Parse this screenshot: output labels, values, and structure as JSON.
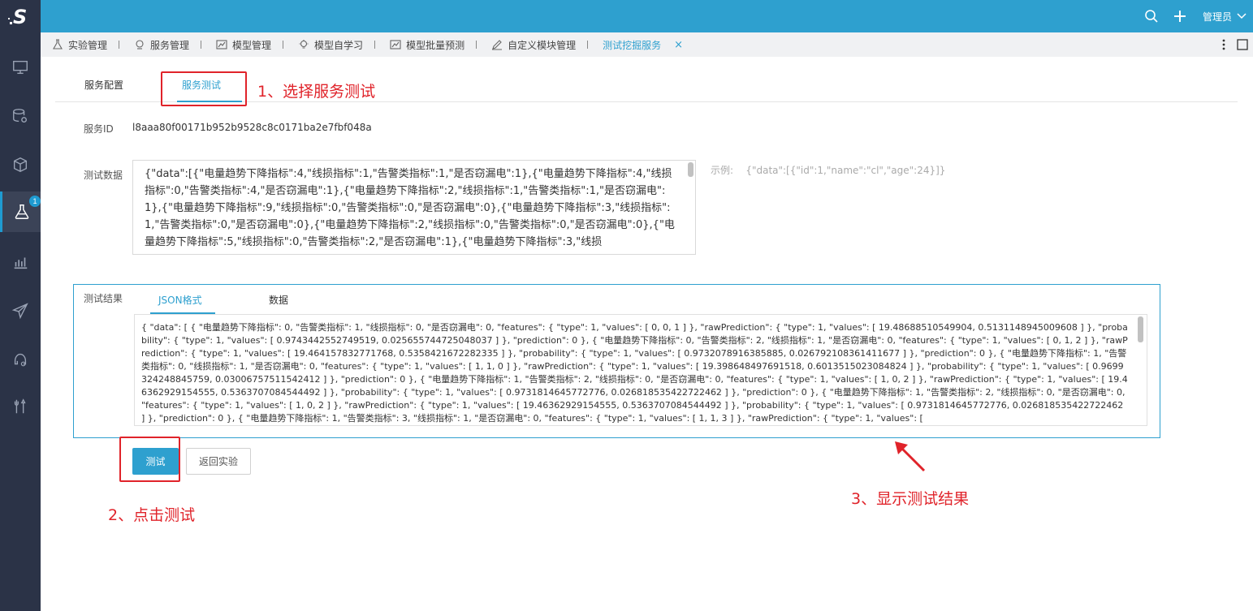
{
  "app": {
    "logo_text": "S",
    "user": "管理员"
  },
  "sidebar": {
    "badge": "1",
    "items": [
      {
        "icon": "monitor-icon"
      },
      {
        "icon": "database-gear-icon"
      },
      {
        "icon": "cube-icon"
      },
      {
        "icon": "flask-icon",
        "active": true
      },
      {
        "icon": "bar-chart-icon"
      },
      {
        "icon": "paper-plane-icon"
      },
      {
        "icon": "model-gear-icon"
      },
      {
        "icon": "tools-icon"
      }
    ]
  },
  "tabs": [
    {
      "label": "实验管理",
      "icon": "flask-icon"
    },
    {
      "label": "服务管理",
      "icon": "service-icon"
    },
    {
      "label": "模型管理",
      "icon": "chart-icon"
    },
    {
      "label": "模型自学习",
      "icon": "bulb-icon"
    },
    {
      "label": "模型批量预测",
      "icon": "chart-icon"
    },
    {
      "label": "自定义模块管理",
      "icon": "edit-icon"
    },
    {
      "label": "测试挖掘服务",
      "active": true,
      "close": "×"
    }
  ],
  "subtabs": {
    "config": "服务配置",
    "test": "服务测试"
  },
  "service": {
    "id_label": "服务ID",
    "id_value": "l8aaa80f00171b952b9528c8c0171ba2e7fbf048a"
  },
  "test_data": {
    "label": "测试数据",
    "value": "{\"data\":[{\"电量趋势下降指标\":4,\"线损指标\":1,\"告警类指标\":1,\"是否窃漏电\":1},{\"电量趋势下降指标\":4,\"线损指标\":0,\"告警类指标\":4,\"是否窃漏电\":1},{\"电量趋势下降指标\":2,\"线损指标\":1,\"告警类指标\":1,\"是否窃漏电\":1},{\"电量趋势下降指标\":9,\"线损指标\":0,\"告警类指标\":0,\"是否窃漏电\":0},{\"电量趋势下降指标\":3,\"线损指标\":1,\"告警类指标\":0,\"是否窃漏电\":0},{\"电量趋势下降指标\":2,\"线损指标\":0,\"告警类指标\":0,\"是否窃漏电\":0},{\"电量趋势下降指标\":5,\"线损指标\":0,\"告警类指标\":2,\"是否窃漏电\":1},{\"电量趋势下降指标\":3,\"线损",
    "example_label": "示例:",
    "example_value": "{\"data\":[{\"id\":1,\"name\":\"cl\",\"age\":24}]}"
  },
  "result": {
    "label": "测试结果",
    "tab_json": "JSON格式",
    "tab_data": "数据",
    "json": "{ \"data\": [ { \"电量趋势下降指标\": 0, \"告警类指标\": 1, \"线损指标\": 0, \"是否窃漏电\": 0, \"features\": { \"type\": 1, \"values\": [ 0, 0, 1 ] }, \"rawPrediction\": { \"type\": 1, \"values\": [ 19.48688510549904, 0.5131148945009608 ] }, \"probability\": { \"type\": 1, \"values\": [ 0.9743442552749519, 0.025655744725048037 ] }, \"prediction\": 0 }, { \"电量趋势下降指标\": 0, \"告警类指标\": 2, \"线损指标\": 1, \"是否窃漏电\": 0, \"features\": { \"type\": 1, \"values\": [ 0, 1, 2 ] }, \"rawPrediction\": { \"type\": 1, \"values\": [ 19.464157832771768, 0.5358421672282335 ] }, \"probability\": { \"type\": 1, \"values\": [ 0.9732078916385885, 0.026792108361411677 ] }, \"prediction\": 0 }, { \"电量趋势下降指标\": 1, \"告警类指标\": 0, \"线损指标\": 1, \"是否窃漏电\": 0, \"features\": { \"type\": 1, \"values\": [ 1, 1, 0 ] }, \"rawPrediction\": { \"type\": 1, \"values\": [ 19.398648497691518, 0.6013515023084824 ] }, \"probability\": { \"type\": 1, \"values\": [ 0.9699324248845759, 0.030067575115424​12 ] }, \"prediction\": 0 }, { \"电量趋势下降指标\": 1, \"告警类指标\": 2, \"线损指标\": 0, \"是否窃漏电\": 0, \"features\": { \"type\": 1, \"values\": [ 1, 0, 2 ] }, \"rawPrediction\": { \"type\": 1, \"values\": [ 19.46362929154555, 0.5363707084544492 ] }, \"probability\": { \"type\": 1, \"values\": [ 0.9731814645772776, 0.026818535422722462 ] }, \"prediction\": 0 }, { \"电量趋势下降指标\": 1, \"告警类指标\": 2, \"线损指标\": 0, \"是否窃漏电\": 0, \"features\": { \"type\": 1, \"values\": [ 1, 0, 2 ] }, \"rawPrediction\": { \"type\": 1, \"values\": [ 19.46362929154555, 0.5363707084544492 ] }, \"probability\": { \"type\": 1, \"values\": [ 0.9731814645772776, 0.026818535422722462 ] }, \"prediction\": 0 }, { \"电量趋势下降指标\": 1, \"告警类指标\": 3, \"线损指标\": 1, \"是否窃漏电\": 0, \"features\": { \"type\": 1, \"values\": [ 1, 1, 3 ] }, \"rawPrediction\": { \"type\": 1, \"values\": ["
  },
  "buttons": {
    "test": "测试",
    "back": "返回实验"
  },
  "annotations": {
    "step1": "1、选择服务测试",
    "step2": "2、点击测试",
    "step3": "3、显示测试结果",
    "color": "#e0232a"
  },
  "colors": {
    "accent": "#2ea0cf",
    "sidebar": "#2b3347"
  }
}
